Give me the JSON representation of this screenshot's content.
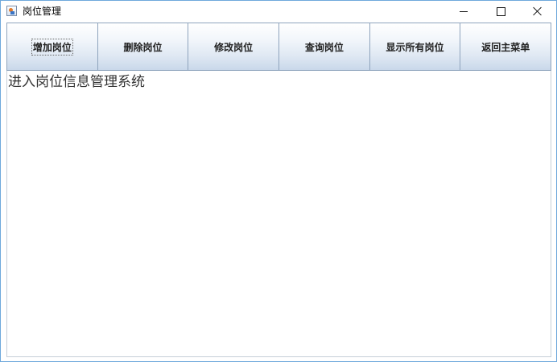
{
  "window": {
    "title": "岗位管理",
    "icon": "java-app-icon",
    "controls": {
      "minimize_icon": "minimize-icon",
      "maximize_icon": "maximize-icon",
      "close_icon": "close-icon"
    }
  },
  "toolbar": {
    "buttons": [
      {
        "label": "增加岗位",
        "focused": true
      },
      {
        "label": "删除岗位"
      },
      {
        "label": "修改岗位"
      },
      {
        "label": "查询岗位"
      },
      {
        "label": "显示所有岗位"
      },
      {
        "label": "返回主菜单"
      }
    ]
  },
  "content": {
    "message": "进入岗位信息管理系统"
  },
  "colors": {
    "window_border": "#6fa8dc",
    "button_border": "#8fa4bd",
    "button_gradient_bottom": "#c9d8ea",
    "text": "#333333"
  }
}
